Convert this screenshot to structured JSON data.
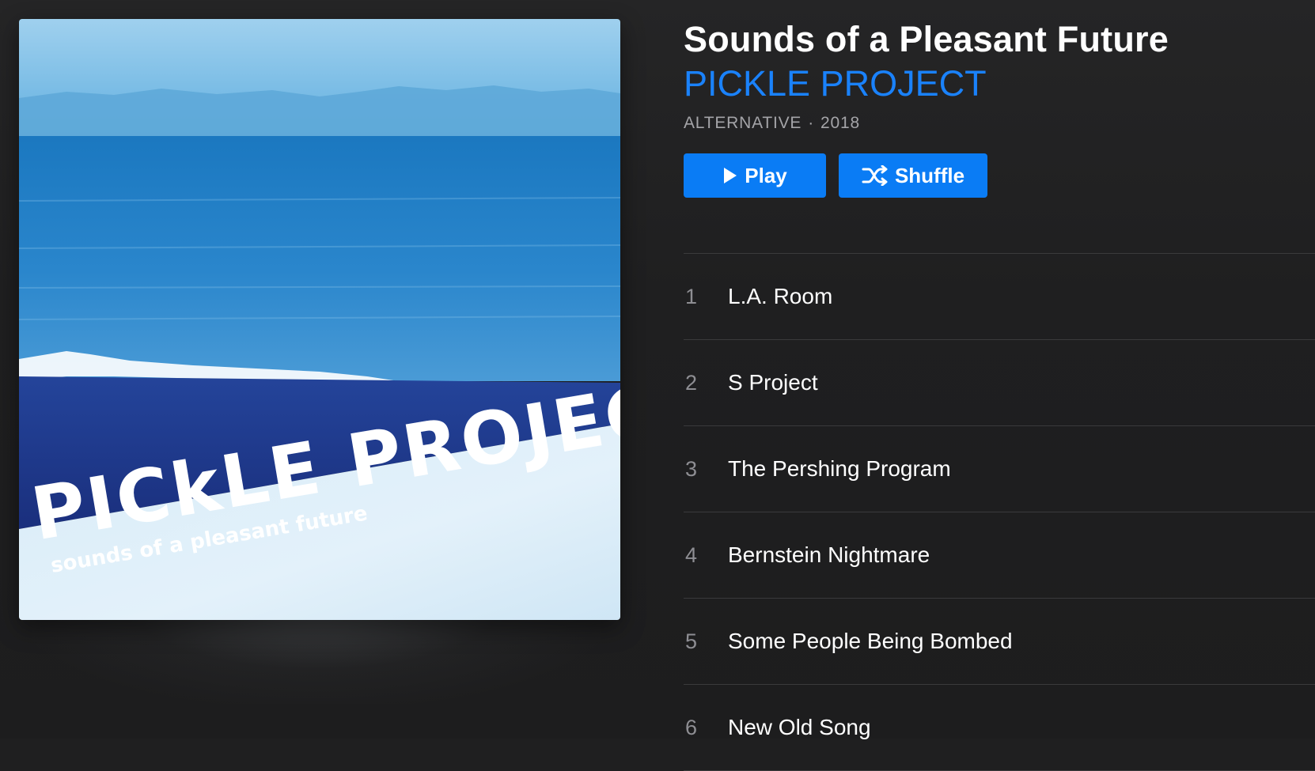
{
  "album": {
    "title": "Sounds of a Pleasant Future",
    "artist": "PICKLE PROJECT",
    "genre": "ALTERNATIVE",
    "separator": "·",
    "year": "2018",
    "cover": {
      "band_text": "PICkLE PROJECT",
      "subtitle_text": "sounds of a pleasant future"
    }
  },
  "actions": {
    "play_label": "Play",
    "shuffle_label": "Shuffle"
  },
  "tracks": [
    {
      "number": "1",
      "title": "L.A. Room"
    },
    {
      "number": "2",
      "title": "S Project"
    },
    {
      "number": "3",
      "title": "The Pershing Program"
    },
    {
      "number": "4",
      "title": "Bernstein Nightmare"
    },
    {
      "number": "5",
      "title": "Some People Being Bombed"
    },
    {
      "number": "6",
      "title": "New Old Song"
    }
  ],
  "colors": {
    "background": "#1f1f20",
    "accent": "#1a82fb",
    "button": "#0a7cf5",
    "secondary_text": "#a4a4a8",
    "divider": "#3a3a3c"
  },
  "icons": {
    "play": "play-icon",
    "shuffle": "shuffle-icon"
  }
}
